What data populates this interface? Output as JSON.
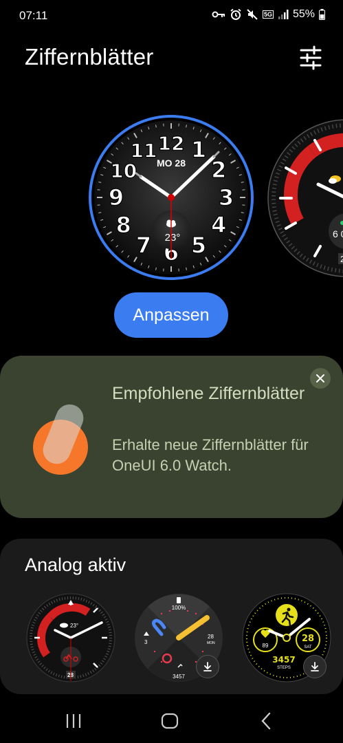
{
  "status_bar": {
    "time": "07:11",
    "network": "5G",
    "battery": "55%",
    "icons": [
      "key-icon",
      "alarm-icon",
      "mute-icon",
      "5g-icon",
      "signal-icon",
      "battery-icon"
    ]
  },
  "header": {
    "title": "Ziffernblätter",
    "settings_icon": "sliders-icon"
  },
  "carousel": {
    "main_face": {
      "date": "MO 28",
      "temperature": "23°",
      "numerals": [
        "12",
        "1",
        "2",
        "3",
        "4",
        "5",
        "6",
        "7",
        "8",
        "9",
        "10",
        "11"
      ],
      "selected": true,
      "ring_color": "#3b7cf0"
    },
    "peek_face": {
      "partial_value": "6 0",
      "partial_digit": "2"
    }
  },
  "customize_button": {
    "label": "Anpassen",
    "color": "#3b7cf0"
  },
  "promo": {
    "title": "Empfohlene Ziffernblätter",
    "description": "Erhalte neue Ziffernblätter für OneUI 6.0 Watch.",
    "close_icon": "close-icon",
    "background": "#39432f",
    "accent": "#f7772a"
  },
  "section": {
    "title": "Analog aktiv",
    "thumbnails": [
      {
        "name": "analog-red",
        "temp": "23°",
        "date": "28",
        "download": false
      },
      {
        "name": "analog-dial",
        "battery": "100%",
        "left_value": "3",
        "date": "28",
        "day": "MON",
        "steps": "3457",
        "download": true
      },
      {
        "name": "analog-yellow",
        "heart": "89",
        "date": "28",
        "day": "SAT",
        "steps": "3457",
        "steps_label": "STEPS",
        "download": true
      }
    ]
  },
  "navbar": {
    "recent_icon": "recent-apps-icon",
    "home_icon": "home-icon",
    "back_icon": "back-icon"
  }
}
